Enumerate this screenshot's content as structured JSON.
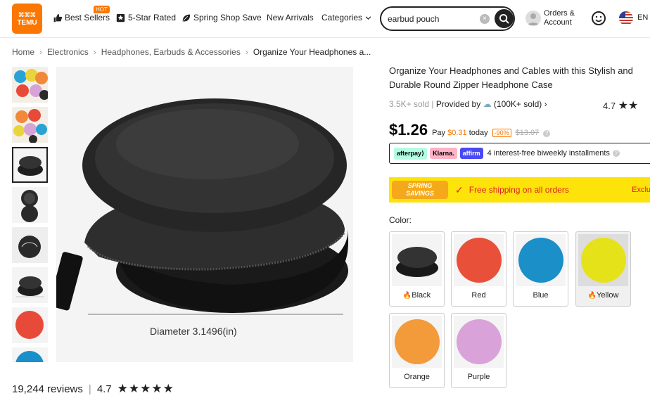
{
  "header": {
    "logo_text": "TEMU",
    "nav": {
      "best_sellers": "Best Sellers",
      "hot_badge": "HOT",
      "five_star": "5-Star Rated",
      "spring_shop": "Spring Shop Save",
      "new_arrivals": "New Arrivals",
      "categories": "Categories"
    },
    "search": {
      "value": "earbud pouch",
      "clear": "×"
    },
    "account": {
      "line1": "Orders &",
      "line2": "Account"
    },
    "language": "EN"
  },
  "breadcrumb": {
    "home": "Home",
    "electronics": "Electronics",
    "headphones": "Headphones, Earbuds & Accessories",
    "current": "Organize Your Headphones a..."
  },
  "main_image": {
    "caption": "Diameter 3.1496(in)"
  },
  "reviews": {
    "count": "19,244 reviews",
    "rating": "4.7",
    "stars": "★★★★★"
  },
  "product": {
    "title": "Organize Your Headphones and Cables with this Stylish and Durable Round Zipper Headphone Case",
    "sold": "3.5K+ sold",
    "provided_by": "Provided by",
    "seller_sold": "(100K+ sold)",
    "rating": "4.7",
    "rating_stars": "★★",
    "price": "$1.26",
    "pay_label": "Pay",
    "pay_amount": "$0.31",
    "pay_today": "today",
    "discount": "-90%",
    "old_price": "$13.07",
    "info": "?"
  },
  "installments": {
    "afterpay": "afterpay⟩",
    "klarna": "Klarna.",
    "affirm": "affirm",
    "text": "4 interest-free biweekly installments",
    "info": "?"
  },
  "promo": {
    "badge_line1": "SPRING",
    "badge_line2": "SAVINGS",
    "check": "✓",
    "text": "Free shipping on all orders",
    "exclusive": "Exclusi"
  },
  "colors": {
    "label": "Color:",
    "options": [
      {
        "name": "Black",
        "hex": "#2a2a2a"
      },
      {
        "name": "Red",
        "hex": "#e8503a"
      },
      {
        "name": "Blue",
        "hex": "#1a8fc8"
      },
      {
        "name": "Yellow",
        "hex": "#e6e21a"
      },
      {
        "name": "Orange",
        "hex": "#f39a3a"
      },
      {
        "name": "Purple",
        "hex": "#d9a3d9"
      }
    ]
  },
  "thumbnails": [
    {
      "icon": "colorful-cases-thumbnail"
    },
    {
      "icon": "colorful-cases-thumbnail"
    },
    {
      "icon": "black-case-thumbnail"
    },
    {
      "icon": "open-case-thumbnail"
    },
    {
      "icon": "case-with-earbuds-thumbnail"
    },
    {
      "icon": "black-case-thumbnail"
    },
    {
      "icon": "red-case-thumbnail"
    },
    {
      "icon": "blue-case-thumbnail"
    }
  ],
  "theme": {
    "accent": "#fb7701",
    "promo_bg": "#fde30a",
    "promo_text": "#e02020"
  }
}
